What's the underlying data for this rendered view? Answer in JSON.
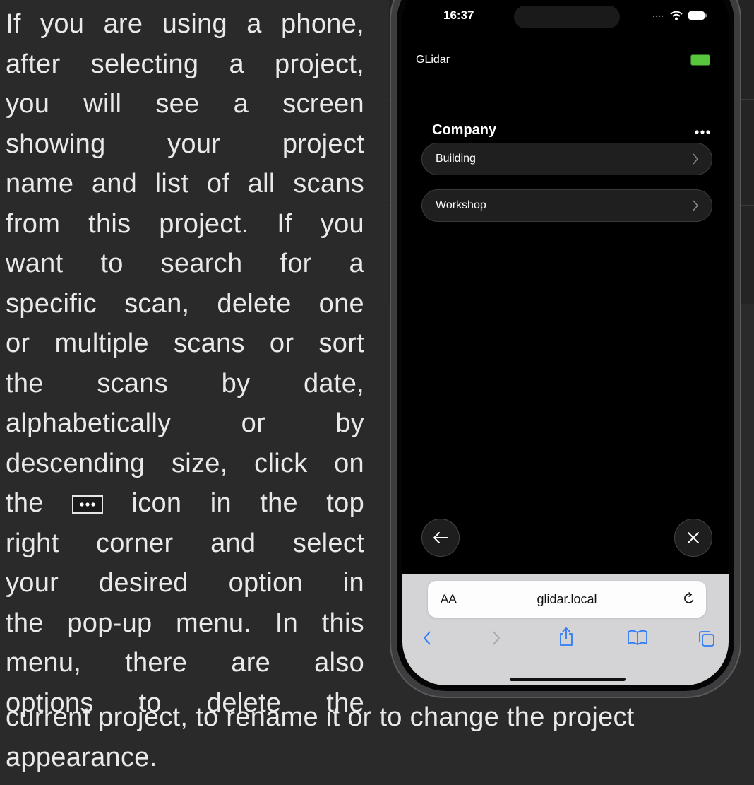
{
  "doc": {
    "lines": [
      "If you are using a phone,",
      "after selecting a project,",
      "you will see a screen",
      "showing your project",
      "name and list of all scans",
      "from this project. If you",
      "want to search for a",
      "specific scan, delete one",
      "or multiple scans or sort",
      "the scans by date,",
      "alphabetically or by",
      "descending size, click on"
    ],
    "icon_line_before": "the",
    "icon_line_after": "icon in the top",
    "lines_after": [
      "right corner and select",
      "your desired option in",
      "the pop-up menu. In this",
      "menu, there are also",
      "options to delete the"
    ],
    "bottom_lines": [
      "current project, to rename it or to change the project",
      "appearance."
    ],
    "inline_icon": "more-dots-icon"
  },
  "phone": {
    "status": {
      "time": "16:37",
      "icons": [
        "signal-icon",
        "wifi-icon",
        "battery-icon"
      ]
    },
    "app_title": "GLidar",
    "app_status_color": "#58c73e",
    "project_name": "Company",
    "more_icon": "more-dots-icon",
    "scans": [
      {
        "label": "Building"
      },
      {
        "label": "Workshop"
      }
    ],
    "nav": {
      "back_icon": "arrow-left-icon",
      "close_icon": "close-icon"
    },
    "browser": {
      "text_size_label": "AA",
      "url": "glidar.local",
      "reload_icon": "reload-icon",
      "toolbar": [
        "back-chevron-icon",
        "forward-chevron-icon",
        "share-icon",
        "bookmarks-icon",
        "tabs-icon"
      ],
      "accent_color": "#2f7cf6"
    }
  }
}
